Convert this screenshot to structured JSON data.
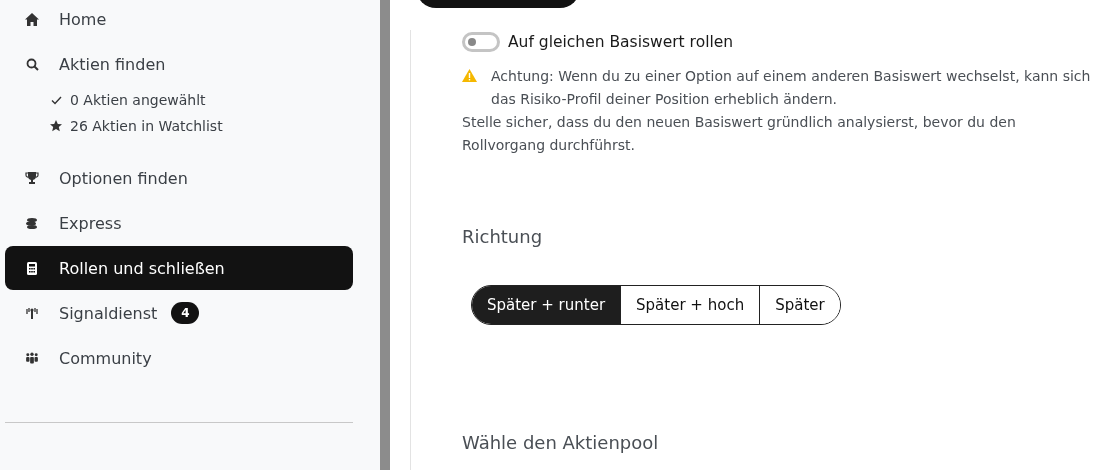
{
  "sidebar": {
    "items": [
      {
        "label": "Home",
        "selected": false
      },
      {
        "label": "Aktien finden",
        "selected": false,
        "children": [
          {
            "label": "0 Aktien angewählt"
          },
          {
            "label": "26 Aktien in Watchlist"
          }
        ]
      },
      {
        "label": "Optionen finden",
        "selected": false
      },
      {
        "label": "Express",
        "selected": false
      },
      {
        "label": "Rollen und schließen",
        "selected": true
      },
      {
        "label": "Signaldienst",
        "selected": false,
        "badge": "4"
      },
      {
        "label": "Community",
        "selected": false
      }
    ]
  },
  "main": {
    "toggle": {
      "label": "Auf gleichen Basiswert rollen",
      "on": false
    },
    "warning": {
      "paragraphs": [
        "Achtung: Wenn du zu einer Option auf einem anderen Basiswert wechselst, kann sich das Risiko-Profil deiner Position erheblich ändern.",
        "Stelle sicher, dass du den neuen Basiswert gründlich analysierst, bevor du den Rollvorgang durchführst."
      ]
    },
    "direction": {
      "heading": "Richtung",
      "options": [
        {
          "label": "Später + runter",
          "selected": true
        },
        {
          "label": "Später + hoch",
          "selected": false
        },
        {
          "label": "Später",
          "selected": false
        }
      ]
    },
    "pool": {
      "heading": "Wähle den Aktienpool"
    }
  }
}
